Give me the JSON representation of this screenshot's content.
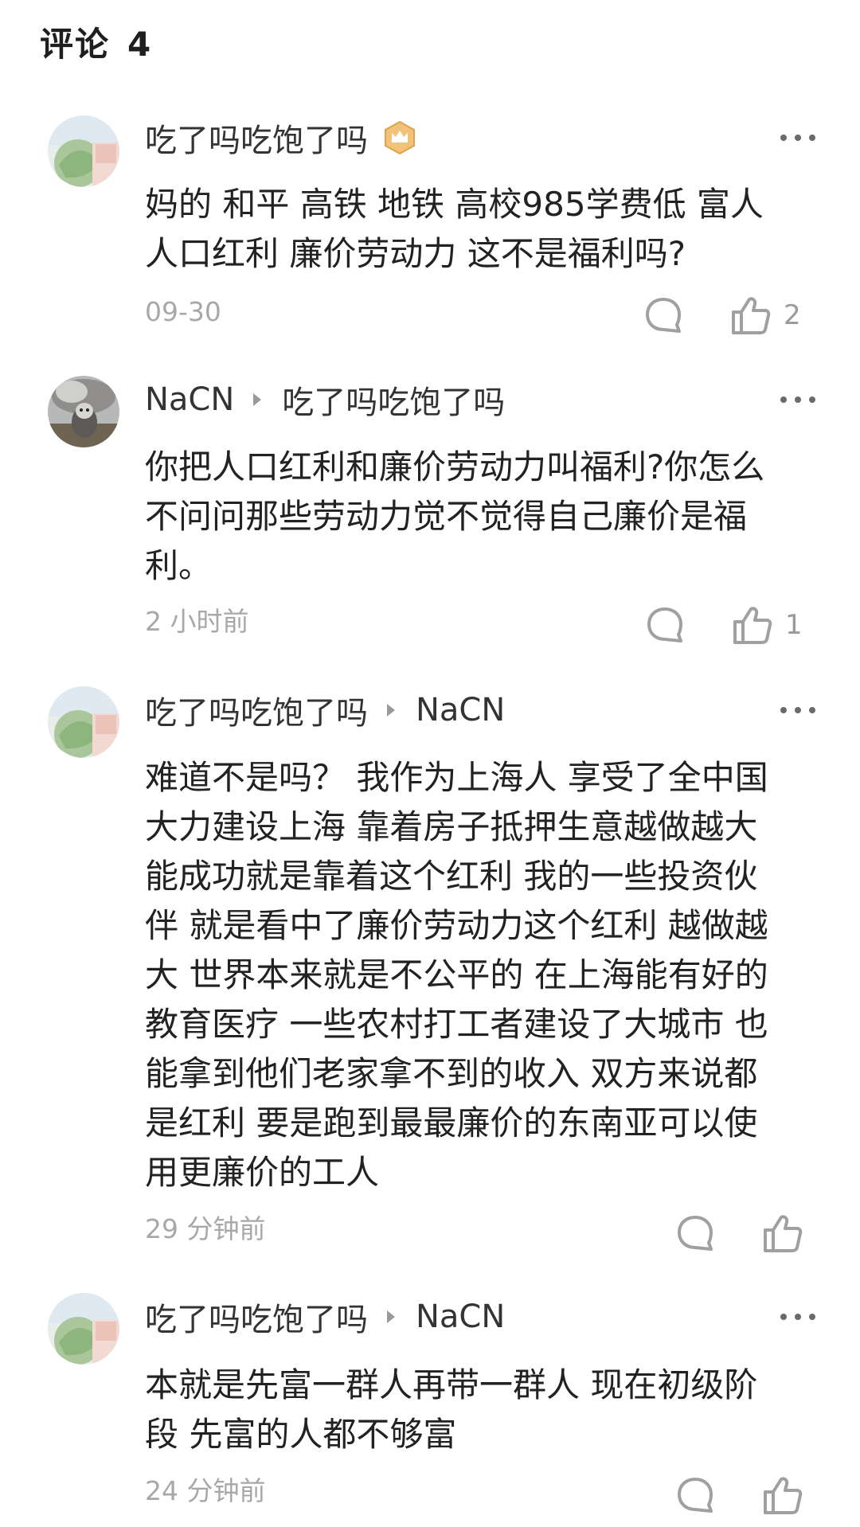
{
  "header": {
    "title": "评论",
    "count": "4"
  },
  "comments": [
    {
      "author": "吃了吗吃饱了吗",
      "reply_to": "",
      "text": "妈的 和平 高铁 地铁 高校985学费低 富人\n人口红利 廉价劳动力 这不是福利吗?",
      "time": "09-30",
      "likes": "2",
      "badge": "crown-badge-icon"
    },
    {
      "author": "NaCN",
      "reply_to": "吃了吗吃饱了吗",
      "text": "你把人口红利和廉价劳动力叫福利?你怎么\n不问问那些劳动力觉不觉得自己廉价是福\n利。",
      "time": "2 小时前",
      "likes": "1"
    },
    {
      "author": "吃了吗吃饱了吗",
      "reply_to": "NaCN",
      "text": "难道不是吗？ 我作为上海人 享受了全中国\n大力建设上海 靠着房子抵押生意越做越大\n能成功就是靠着这个红利 我的一些投资伙\n伴 就是看中了廉价劳动力这个红利 越做越\n大 世界本来就是不公平的 在上海能有好的\n教育医疗 一些农村打工者建设了大城市 也\n能拿到他们老家拿不到的收入 双方来说都\n是红利 要是跑到最最廉价的东南亚可以使\n用更廉价的工人",
      "time": "29 分钟前",
      "likes": ""
    },
    {
      "author": "吃了吗吃饱了吗",
      "reply_to": "NaCN",
      "text": "本就是先富一群人再带一群人 现在初级阶\n段 先富的人都不够富",
      "time": "24 分钟前",
      "likes": ""
    }
  ],
  "colors": {
    "author": "#333333",
    "meta": "#a8a8a8",
    "icon": "#a0a0a0",
    "badge": "#e0a24a"
  }
}
